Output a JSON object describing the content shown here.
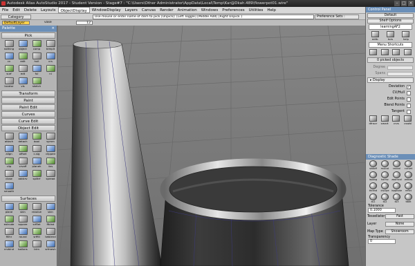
{
  "app": {
    "title": "Autodesk Alias AutoStudio 2017 - Student Version - Stage#7 : \"C:\\Users\\Other Administrator\\AppData\\Local\\Temp\\Kar@Dkah.489\\flowerpot01.wire\""
  },
  "menus": [
    "File",
    "Edit",
    "Delete",
    "Layouts",
    "ObjectDisplay",
    "WindowDisplay",
    "Layers",
    "Canvas",
    "Render",
    "Animation",
    "Windows",
    "Preferences",
    "Utilities",
    "Help"
  ],
  "active_menu": "ObjectDisplay",
  "prompt": {
    "category": "Category",
    "text": "Use mouse or enter name of item to pick [Unpick]: [Left Toggle] [Middle Add] [Right Unpick ]",
    "pref_sets": "Preference Sets :"
  },
  "layers": {
    "default": "DefaultLayer",
    "object_name": "vase",
    "value": "12"
  },
  "palette": {
    "title": "Palette",
    "sections": [
      {
        "name": "Pick",
        "tools": [
          "nothing",
          "object",
          "comp",
          "templt",
          "cv",
          "edit",
          "hull",
          "crs",
          "surf",
          "edt",
          "ful",
          "nl",
          "locator",
          "vis",
          "sketch"
        ]
      },
      {
        "name": "Transform",
        "tools": []
      },
      {
        "name": "Paint",
        "tools": []
      },
      {
        "name": "Paint Edit",
        "tools": []
      },
      {
        "name": "Curves",
        "tools": []
      },
      {
        "name": "Curve Edit",
        "tools": []
      },
      {
        "name": "Object Edit",
        "tools": [
          "attach",
          "detach",
          "bool",
          "symm",
          "align",
          "offset",
          "c-sig",
          "clipped",
          "clip",
          "crvoff",
          "planeh",
          "lins",
          "close",
          "addcrv",
          "splitrf",
          "spread",
          "smooth"
        ]
      },
      {
        "name": "Surfaces",
        "tools": [
          "plane",
          "skin",
          "revolve",
          "skin",
          "extrude",
          "square",
          "srfflet",
          "ffblnd",
          "fillhr",
          "round",
          "srffill",
          "twblend",
          "crvblnd",
          "ballons",
          "trim",
          "srfmesh"
        ]
      }
    ]
  },
  "control_panel": {
    "title": "Control Panel",
    "preset": "Default",
    "shelf": "Shelf Options",
    "shelf_tab": "learningAF2",
    "shelf_tools": [
      "edtb",
      "tors",
      "help"
    ],
    "menu_shortcuts": "Menu Shortcuts",
    "picked": "0 picked objects",
    "properties": [
      "Degree",
      "Spans"
    ],
    "display_label": "Display",
    "display_items": [
      {
        "label": "Deviation",
        "checked": true
      },
      {
        "label": "CV/Hull",
        "checked": false
      },
      {
        "label": "Edit Points",
        "checked": false
      },
      {
        "label": "Blend Points",
        "checked": false
      },
      {
        "label": "Tangent",
        "checked": false
      }
    ],
    "bottom_tools": [
      "dfnscr",
      "smart",
      "crvs",
      "cswbl"
    ]
  },
  "diagnostic": {
    "title": "Diagnostic Shade",
    "tools": [
      "shdoff",
      "mulcol",
      "rancol",
      "curvet",
      "isoang",
      "horrsc",
      "zoomcol",
      "zebras",
      "thrend",
      "clscipe",
      "isophote",
      "reflct",
      "ss1",
      "ss2",
      "ss3",
      "tbalt"
    ],
    "tolerance_label": "Tolerance",
    "tolerance_value": "0.1000",
    "tessellator_label": "Tessellator",
    "tessellator_value": "Fast",
    "layer_label": "Layer",
    "layer_value": "None",
    "maptype_label": "Map Type",
    "maptype_value": "Showroom",
    "transparency_label": "Transparency",
    "transparency_value": "0"
  },
  "colors": {
    "title_bar": "#2d2d2d",
    "palette_header": "#6b8fb8",
    "viewport_bg": "#7c7c7c",
    "grid": "#6a6a6a"
  }
}
